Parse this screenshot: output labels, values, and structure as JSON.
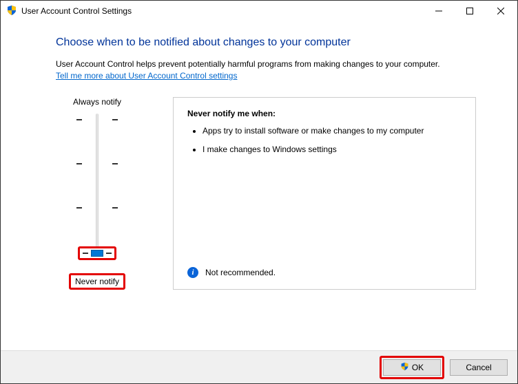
{
  "window": {
    "title": "User Account Control Settings"
  },
  "heading": "Choose when to be notified about changes to your computer",
  "description": "User Account Control helps prevent potentially harmful programs from making changes to your computer.",
  "link_text": "Tell me more about User Account Control settings",
  "slider": {
    "top_label": "Always notify",
    "bottom_label": "Never notify"
  },
  "info": {
    "title": "Never notify me when:",
    "bullets": [
      "Apps try to install software or make changes to my computer",
      "I make changes to Windows settings"
    ],
    "recommendation": "Not recommended."
  },
  "buttons": {
    "ok": "OK",
    "cancel": "Cancel"
  }
}
